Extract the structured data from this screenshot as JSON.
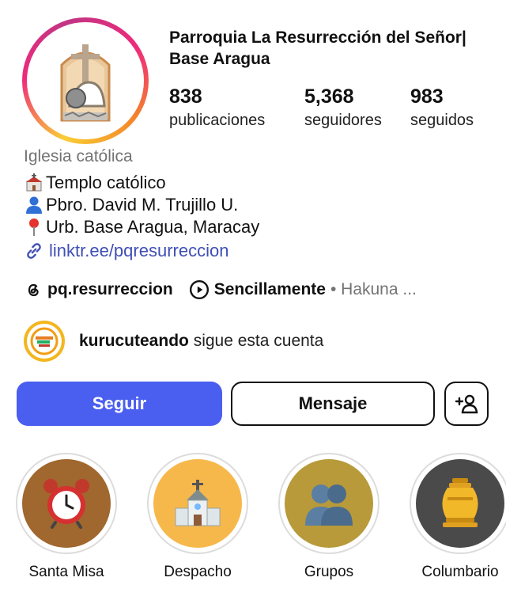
{
  "profile": {
    "name": "Parroquia La Resurrección del Señor| Base Aragua",
    "stats": [
      {
        "value": "838",
        "label": "publicaciones"
      },
      {
        "value": "5,368",
        "label": "seguidores"
      },
      {
        "value": "983",
        "label": "seguidos"
      }
    ],
    "category": "Iglesia católica",
    "bio": [
      {
        "icon": "church-emoji-icon",
        "text": "Templo católico"
      },
      {
        "icon": "person-emoji-icon",
        "text": "Pbro. David M. Trujillo U."
      },
      {
        "icon": "pin-emoji-icon",
        "text": "Urb. Base Aragua, Maracay"
      }
    ],
    "link": "linktr.ee/pqresurreccion",
    "threads_handle": "pq.resurreccion",
    "music_title": "Sencillamente",
    "music_artist": "• Hakuna ...",
    "followed_by_user": "kurucuteando",
    "followed_by_suffix": " sigue esta cuenta"
  },
  "actions": {
    "follow": "Seguir",
    "message": "Mensaje"
  },
  "highlights": [
    {
      "label": "Santa Misa",
      "icon": "alarm-clock-icon",
      "bg": "#a0672e"
    },
    {
      "label": "Despacho",
      "icon": "church-building-icon",
      "bg": "#f7b84b"
    },
    {
      "label": "Grupos",
      "icon": "people-silhouette-icon",
      "bg": "#b89a3a"
    },
    {
      "label": "Columbario",
      "icon": "urn-icon",
      "bg": "#4a4a4a"
    }
  ],
  "colors": {
    "accent": "#4a5ef0",
    "link": "#3f4fb5",
    "muted": "#737373"
  }
}
